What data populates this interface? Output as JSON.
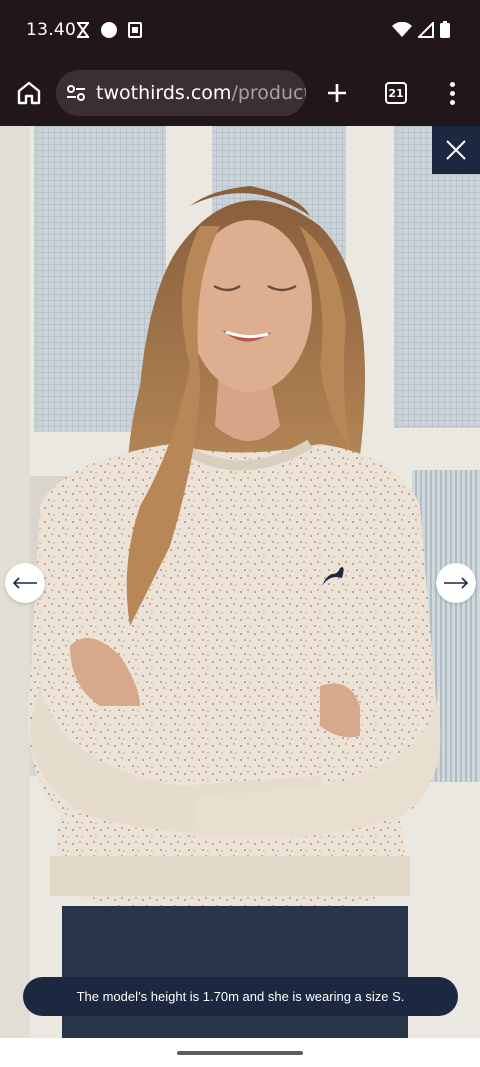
{
  "status_bar": {
    "time": "13.40",
    "icons": [
      "hourglass-icon",
      "circle-icon",
      "sim-icon",
      "wifi-icon",
      "signal-icon",
      "battery-icon"
    ]
  },
  "browser": {
    "url_host": "twothirds.com",
    "url_path": "/products",
    "tab_count": "21",
    "icons": [
      "home-icon",
      "site-settings-icon",
      "plus-icon",
      "more-vert-icon"
    ]
  },
  "gallery": {
    "caption": "The model’s height is 1.70m and she is wearing a size S.",
    "icons": [
      "close-icon",
      "arrow-left-icon",
      "arrow-right-icon"
    ],
    "accent_color": "#1c2740"
  }
}
